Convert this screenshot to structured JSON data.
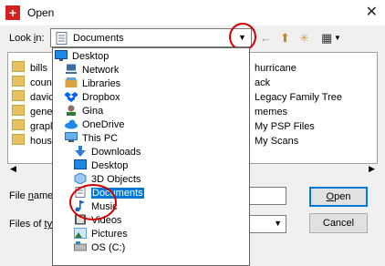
{
  "window": {
    "title": "Open",
    "close": "✕"
  },
  "lookin": {
    "label_pre": "Look ",
    "label_key": "i",
    "label_post": "n:",
    "value": "Documents",
    "arrow": "▼"
  },
  "toolbar": {
    "back": "←",
    "up": "⬆",
    "new_folder": "✳",
    "view": "▦"
  },
  "files": [
    {
      "name": "bills"
    },
    {
      "name": "coun"
    },
    {
      "name": "davic"
    },
    {
      "name": "gene"
    },
    {
      "name": "grapl"
    },
    {
      "name": "hous"
    },
    {
      "name": "hurricane"
    },
    {
      "name": "ack"
    },
    {
      "name": "Legacy Family Tree"
    },
    {
      "name": "memes"
    },
    {
      "name": "My PSP Files"
    },
    {
      "name": "My Scans"
    }
  ],
  "scroll": {
    "left": "◀",
    "right": "▶"
  },
  "filename": {
    "label_pre": "File ",
    "label_key": "n",
    "label_post": "ame",
    "value": ""
  },
  "filetype": {
    "label_pre": "Files of ",
    "label_key": "ty",
    "label_post": "p",
    "value": "",
    "arrow": "▼"
  },
  "buttons": {
    "open_key": "O",
    "open_rest": "pen",
    "cancel": "Cancel"
  },
  "dropdown": [
    {
      "label": "Desktop",
      "icon": "desktop-icon",
      "color": "#1e88e5"
    },
    {
      "label": "Network",
      "icon": "network-icon",
      "color": "#3a6ea5"
    },
    {
      "label": "Libraries",
      "icon": "libraries-icon",
      "color": "#d9a441"
    },
    {
      "label": "Dropbox",
      "icon": "dropbox-icon",
      "color": "#0061fe"
    },
    {
      "label": "Gina",
      "icon": "user-icon",
      "color": "#8d6e63"
    },
    {
      "label": "OneDrive",
      "icon": "onedrive-icon",
      "color": "#1e88e5"
    },
    {
      "label": "This PC",
      "icon": "computer-icon",
      "color": "#4a90d9"
    },
    {
      "label": "Downloads",
      "icon": "downloads-icon",
      "color": "#2b7cd3"
    },
    {
      "label": "Desktop",
      "icon": "desktop-icon",
      "color": "#1e88e5"
    },
    {
      "label": "3D Objects",
      "icon": "3d-objects-icon",
      "color": "#5aa0e0"
    },
    {
      "label": "Documents",
      "icon": "documents-icon",
      "color": "#7f8fa8"
    },
    {
      "label": "Music",
      "icon": "music-icon",
      "color": "#1565c0"
    },
    {
      "label": "Videos",
      "icon": "videos-icon",
      "color": "#555555"
    },
    {
      "label": "Pictures",
      "icon": "pictures-icon",
      "color": "#5aa0e0"
    },
    {
      "label": "OS (C:)",
      "icon": "drive-icon",
      "color": "#777777"
    }
  ]
}
